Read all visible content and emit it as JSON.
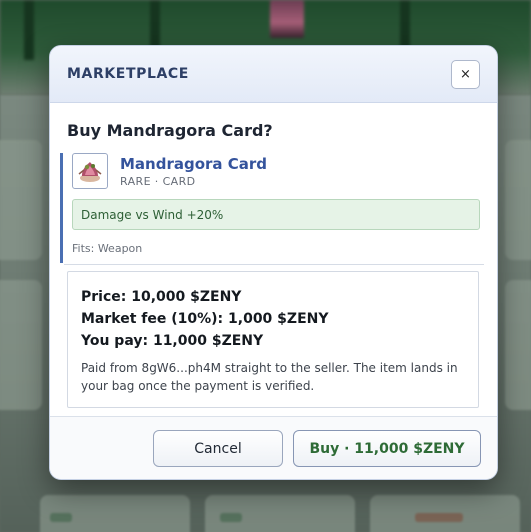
{
  "modal": {
    "title": "MARKETPLACE",
    "close_label": "×",
    "heading": "Buy Mandragora Card?"
  },
  "item": {
    "name": "Mandragora Card",
    "meta": "RARE · CARD",
    "effect": "Damage vs Wind +20%",
    "fits": "Fits: Weapon",
    "icon": "mandragora-card-icon"
  },
  "pricing": {
    "price": "Price: 10,000 $ZENY",
    "fee": "Market fee (10%): 1,000 $ZENY",
    "total": "You pay: 11,000 $ZENY",
    "note": "Paid from 8gW6...ph4M straight to the seller. The item lands in your bag once the payment is verified."
  },
  "footer": {
    "cancel_label": "Cancel",
    "buy_label": "Buy · 11,000 $ZENY"
  },
  "colors": {
    "accent": "#34539c",
    "buy_text": "#2e6b36",
    "effect_bg": "#e6f3e7"
  }
}
